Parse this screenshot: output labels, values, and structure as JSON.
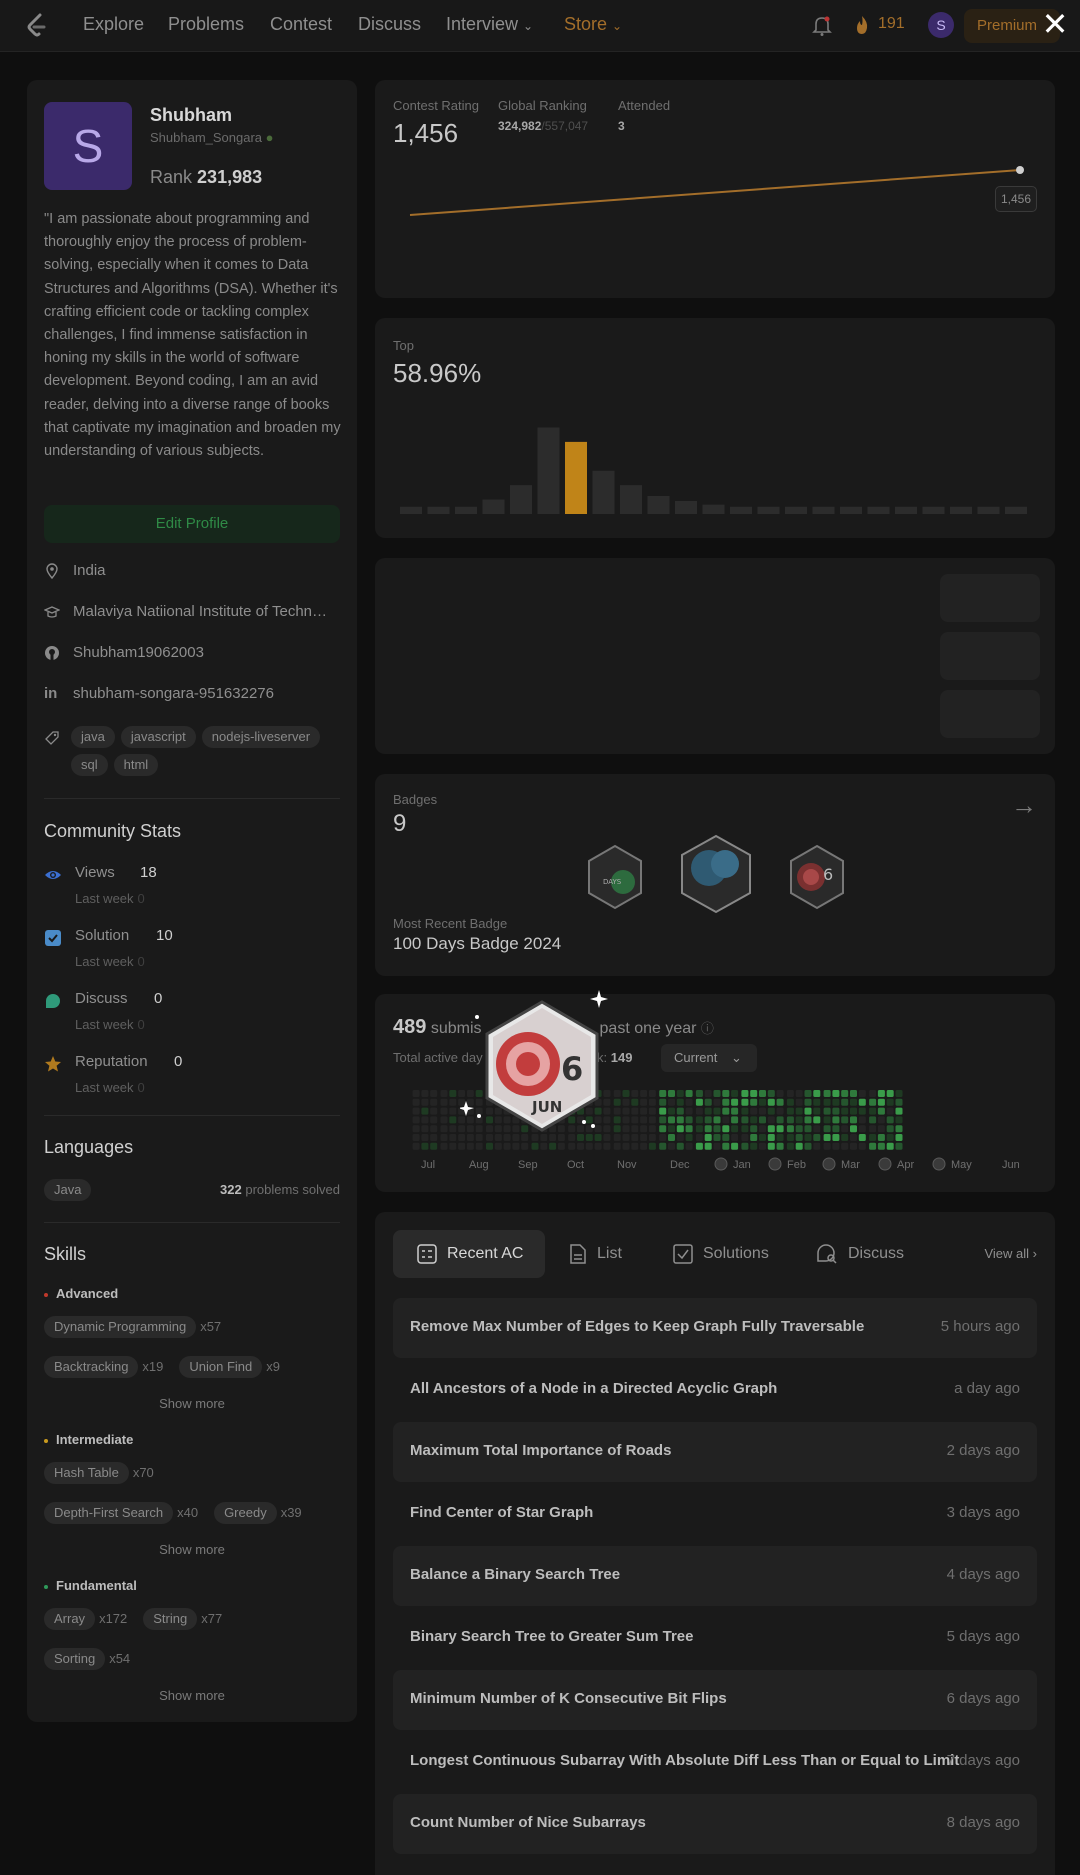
{
  "nav": {
    "items": [
      "Explore",
      "Problems",
      "Contest",
      "Discuss",
      "Interview",
      "Store"
    ],
    "streak": "191",
    "avatar_letter": "S",
    "premium": "Premium",
    "close": "✕"
  },
  "profile": {
    "avatar_letter": "S",
    "name": "Shubham",
    "handle": "Shubham_Songara",
    "rank_label": "Rank",
    "rank_value": "231,983",
    "bio": "\"I am passionate about programming and thoroughly enjoy the process of problem-solving, especially when it comes to Data Structures and Algorithms (DSA). Whether it's crafting efficient code or tackling complex challenges, I find immense satisfaction in honing my skills in the world of software development. Beyond coding, I am an avid reader, delving into a diverse range of books that captivate my imagination and broaden my understanding of various subjects.",
    "edit_button": "Edit Profile",
    "location": "India",
    "school": "Malaviya Natiional Institute of Techn…",
    "github": "Shubham19062003",
    "linkedin": "shubham-songara-951632276",
    "tags": [
      "java",
      "javascript",
      "nodejs-liveserver",
      "sql",
      "html"
    ]
  },
  "community": {
    "title": "Community Stats",
    "last_week_label": "Last week",
    "stats": [
      {
        "label": "Views",
        "value": "18",
        "last_week": "0",
        "color": "#3b6fd1"
      },
      {
        "label": "Solution",
        "value": "10",
        "last_week": "0",
        "color": "#4a8bc8"
      },
      {
        "label": "Discuss",
        "value": "0",
        "last_week": "0",
        "color": "#2f9a7a"
      },
      {
        "label": "Reputation",
        "value": "0",
        "last_week": "0",
        "color": "#b07a1e"
      }
    ]
  },
  "languages": {
    "title": "Languages",
    "items": [
      {
        "name": "Java",
        "count": "322",
        "suffix": "problems solved"
      }
    ]
  },
  "skills": {
    "title": "Skills",
    "show_more": "Show more",
    "groups": [
      {
        "name": "Advanced",
        "color": "#c0392b",
        "rows": [
          [
            {
              "tag": "Dynamic Programming",
              "count": "x57"
            }
          ],
          [
            {
              "tag": "Backtracking",
              "count": "x19"
            },
            {
              "tag": "Union Find",
              "count": "x9"
            }
          ]
        ]
      },
      {
        "name": "Intermediate",
        "color": "#c99a1e",
        "rows": [
          [
            {
              "tag": "Hash Table",
              "count": "x70"
            }
          ],
          [
            {
              "tag": "Depth-First Search",
              "count": "x40"
            },
            {
              "tag": "Greedy",
              "count": "x39"
            }
          ]
        ]
      },
      {
        "name": "Fundamental",
        "color": "#2f9a5a",
        "rows": [
          [
            {
              "tag": "Array",
              "count": "x172"
            },
            {
              "tag": "String",
              "count": "x77"
            }
          ],
          [
            {
              "tag": "Sorting",
              "count": "x54"
            }
          ]
        ]
      }
    ]
  },
  "contest": {
    "rating_label": "Contest Rating",
    "rating": "1,456",
    "global_label": "Global Ranking",
    "global_rank": "324,982",
    "global_total": "/557,047",
    "attended_label": "Attended",
    "attended": "3",
    "tooltip": "1,456",
    "line_color": "#a36e2a"
  },
  "top": {
    "label": "Top",
    "value": "58.96%",
    "highlight_index": 6,
    "highlight_color": "#c08418"
  },
  "chart_data": {
    "type": "bar",
    "values": [
      1,
      1,
      1,
      2,
      4,
      12,
      10,
      6,
      4,
      2.5,
      1.8,
      1.3,
      1,
      1,
      1,
      1,
      1,
      1,
      1,
      1,
      1,
      1,
      1
    ],
    "ylim": [
      0,
      13
    ]
  },
  "badges": {
    "label": "Badges",
    "count": "9",
    "recent_label": "Most Recent Badge",
    "recent_name": "100 Days Badge 2024"
  },
  "submissions": {
    "count": "489",
    "text_prefix": "submis",
    "text_suffix": "past one year",
    "active_label": "Total active day",
    "max_streak_suffix": "k:",
    "max_streak": "149",
    "select": "Current",
    "months": [
      "Jul",
      "Aug",
      "Sep",
      "Oct",
      "Nov",
      "Dec",
      "Jan",
      "Feb",
      "Mar",
      "Apr",
      "May",
      "Jun"
    ],
    "overlay_badge_day": "6",
    "overlay_badge_month": "JUN"
  },
  "recent": {
    "tabs": [
      "Recent AC",
      "List",
      "Solutions",
      "Discuss"
    ],
    "view_all": "View all",
    "items": [
      {
        "title": "Remove Max Number of Edges to Keep Graph Fully Traversable",
        "time": "5 hours ago"
      },
      {
        "title": "All Ancestors of a Node in a Directed Acyclic Graph",
        "time": "a day ago"
      },
      {
        "title": "Maximum Total Importance of Roads",
        "time": "2 days ago"
      },
      {
        "title": "Find Center of Star Graph",
        "time": "3 days ago"
      },
      {
        "title": "Balance a Binary Search Tree",
        "time": "4 days ago"
      },
      {
        "title": "Binary Search Tree to Greater Sum Tree",
        "time": "5 days ago"
      },
      {
        "title": "Minimum Number of K Consecutive Bit Flips",
        "time": "6 days ago"
      },
      {
        "title": "Longest Continuous Subarray With Absolute Diff Less Than or Equal to Limit",
        "time": "7 days ago"
      },
      {
        "title": "Count Number of Nice Subarrays",
        "time": "8 days ago"
      }
    ]
  }
}
